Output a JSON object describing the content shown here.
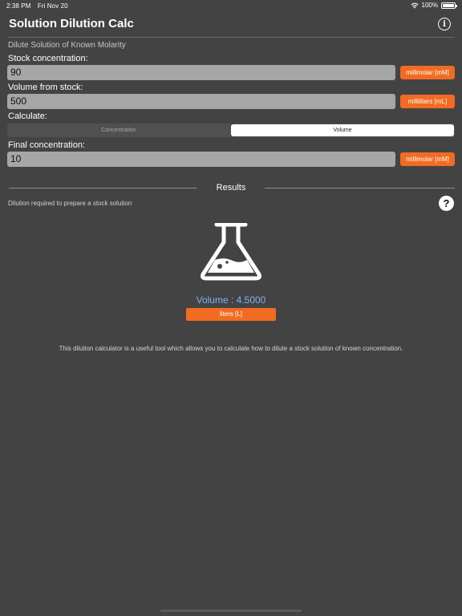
{
  "status_bar": {
    "time": "2:38 PM",
    "date": "Fri Nov 20",
    "battery": "100%",
    "icons": [
      "wifi-icon",
      "battery-icon"
    ]
  },
  "header": {
    "title": "Solution Dilution Calc",
    "info_icon": "info-icon"
  },
  "subtitle": "Dilute Solution of Known Molarity",
  "fields": {
    "stock_concentration": {
      "label": "Stock concentration:",
      "value": "90",
      "unit": "millimolar [mM]"
    },
    "volume_from_stock": {
      "label": "Volume from stock:",
      "value": "500",
      "unit": "milliliters [mL]"
    },
    "calculate": {
      "label": "Calculate:",
      "options": [
        "Concentration",
        "Volume"
      ],
      "selected": "Volume"
    },
    "final_concentration": {
      "label": "Final concentration:",
      "value": "10",
      "unit": "millimolar [mM]"
    }
  },
  "results": {
    "title": "Results",
    "description": "Dilution required to prepare a stock solution",
    "help_icon": "question-icon",
    "icon": "flask-icon",
    "value_text": "Volume : 4.5000",
    "unit_button": "liters [L]",
    "footer": "This dilution calculator is a useful tool which allows you to calculate how to dilute a stock solution of known concentration."
  },
  "colors": {
    "background": "#434343",
    "accent": "#f26b22",
    "result_value": "#7db3f0",
    "input_bg": "#a6a6a6"
  }
}
